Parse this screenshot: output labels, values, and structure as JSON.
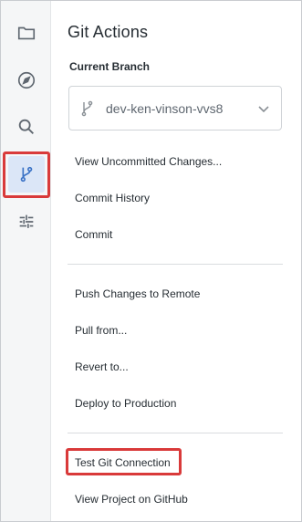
{
  "rail": {
    "items": [
      {
        "icon": "folder-icon"
      },
      {
        "icon": "compass-icon"
      },
      {
        "icon": "search-icon"
      },
      {
        "icon": "git-branch-icon",
        "active": true
      },
      {
        "icon": "sliders-icon"
      }
    ]
  },
  "panel": {
    "title": "Git Actions",
    "branch_label": "Current Branch",
    "branch_value": "dev-ken-vinson-vvs8",
    "groups": [
      [
        "View Uncommitted Changes...",
        "Commit History",
        "Commit"
      ],
      [
        "Push Changes to Remote",
        "Pull from...",
        "Revert to...",
        "Deploy to Production"
      ],
      [
        "Test Git Connection",
        "View Project on GitHub"
      ]
    ]
  },
  "colors": {
    "accent": "#3b73c6",
    "highlight": "#d93a3a",
    "active_bg": "#dbe6f7"
  }
}
